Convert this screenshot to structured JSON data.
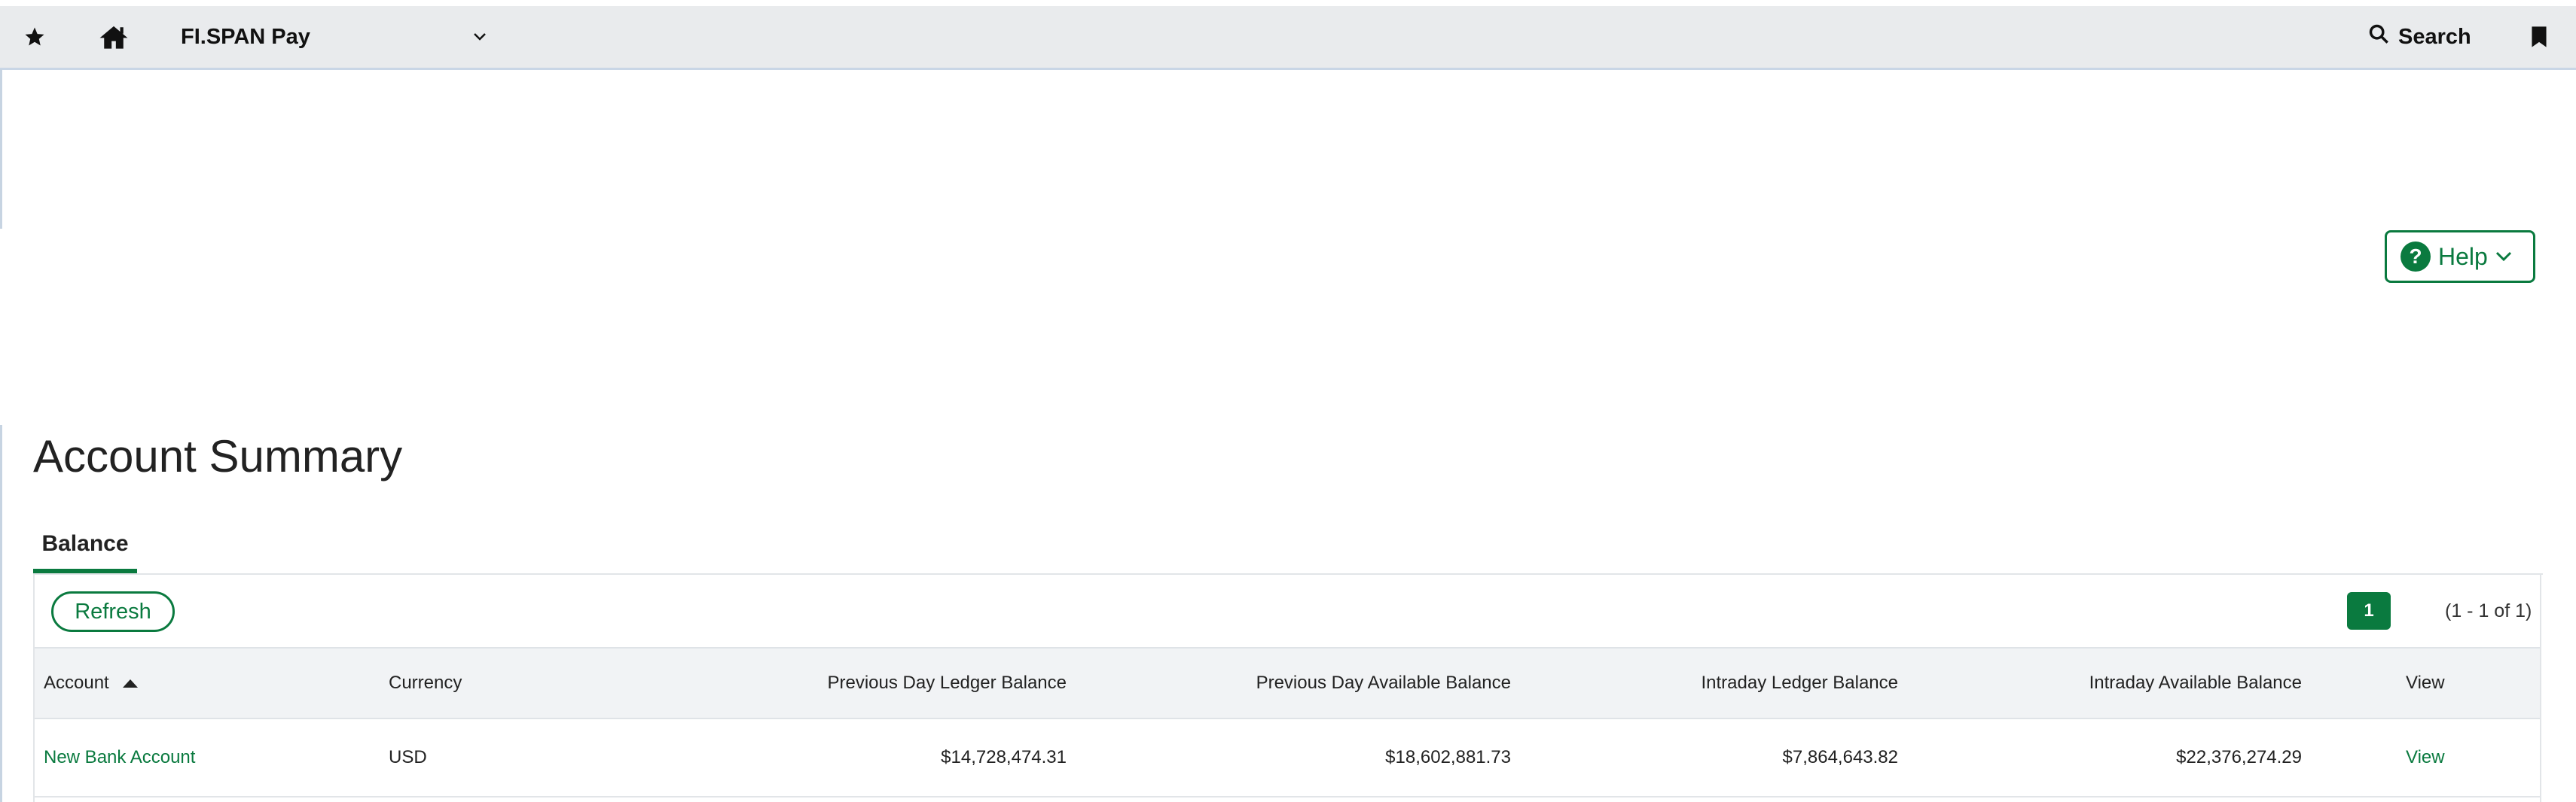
{
  "topbar": {
    "app_title": "FI.SPAN Pay",
    "search_label": "Search"
  },
  "help": {
    "label": "Help"
  },
  "page": {
    "title": "Account Summary",
    "active_tab": "Balance"
  },
  "toolbar": {
    "refresh_label": "Refresh",
    "current_page": "1",
    "range_text": "(1 - 1 of 1)"
  },
  "table": {
    "columns": [
      "Account",
      "Currency",
      "Previous Day Ledger Balance",
      "Previous Day Available Balance",
      "Intraday Ledger Balance",
      "Intraday Available Balance",
      "View"
    ],
    "sort": {
      "column": "Account",
      "direction": "ascending"
    },
    "rows": [
      {
        "account": "New Bank Account",
        "currency": "USD",
        "prev_ledger": "$14,728,474.31",
        "prev_available": "$18,602,881.73",
        "intraday_ledger": "$7,864,643.82",
        "intraday_available": "$22,376,274.29",
        "view": "View"
      }
    ]
  },
  "colors": {
    "accent": "#0a7a3f",
    "topbar_bg": "#e9ebed",
    "header_bg": "#f1f3f5"
  }
}
